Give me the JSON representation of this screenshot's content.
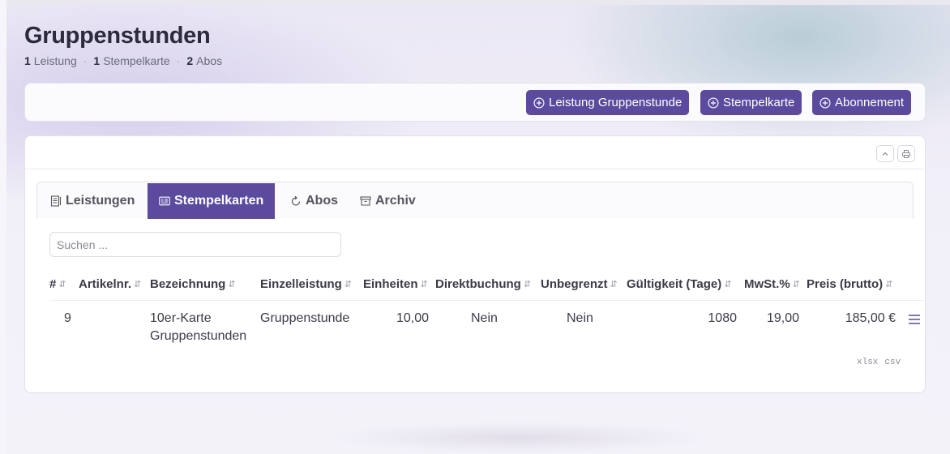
{
  "page": {
    "title": "Gruppenstunden",
    "summary": [
      {
        "count": "1",
        "label": "Leistung"
      },
      {
        "count": "1",
        "label": "Stempelkarte"
      },
      {
        "count": "2",
        "label": "Abos"
      }
    ],
    "separator": "·"
  },
  "toolbar": {
    "buttons": [
      {
        "label": "Leistung Gruppenstunde",
        "icon": "plus-circle-icon"
      },
      {
        "label": "Stempelkarte",
        "icon": "plus-circle-icon"
      },
      {
        "label": "Abonnement",
        "icon": "plus-circle-icon"
      }
    ]
  },
  "card": {
    "actions": [
      {
        "name": "collapse",
        "icon": "chevron-up-icon"
      },
      {
        "name": "print",
        "icon": "printer-icon"
      }
    ],
    "tabs": [
      {
        "label": "Leistungen",
        "icon": "list-icon",
        "active": false
      },
      {
        "label": "Stempelkarten",
        "icon": "card-icon",
        "active": true
      },
      {
        "label": "Abos",
        "icon": "refresh-icon",
        "active": false
      },
      {
        "label": "Archiv",
        "icon": "archive-icon",
        "active": false
      }
    ],
    "search": {
      "placeholder": "Suchen ...",
      "value": ""
    },
    "sort_glyph": "⇵",
    "table": {
      "columns": [
        "#",
        "Artikelnr.",
        "Bezeichnung",
        "Einzelleistung",
        "Einheiten",
        "Direktbuchung",
        "Unbegrenzt",
        "Gültigkeit (Tage)",
        "MwSt.%",
        "Preis (brutto)"
      ],
      "rows": [
        {
          "id": "9",
          "artikelnr": "",
          "bezeichnung_line1": "10er-Karte",
          "bezeichnung_line2": "Gruppenstunden",
          "einzelleistung": "Gruppenstunde",
          "einheiten": "10,00",
          "direktbuchung": "Nein",
          "unbegrenzt": "Nein",
          "gueltigkeit": "1080",
          "mwst": "19,00",
          "preis": "185,00 €"
        }
      ]
    },
    "exports": [
      "xlsx",
      "csv"
    ]
  },
  "colors": {
    "accent": "#5b4a9e",
    "text": "#3b3b48",
    "muted": "#8a8a96"
  }
}
